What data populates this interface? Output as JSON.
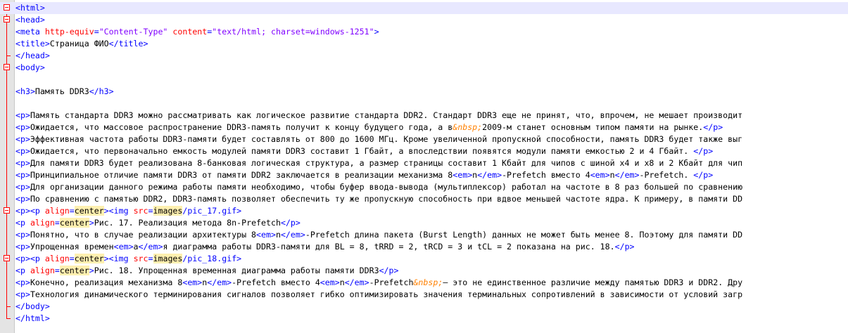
{
  "editor": {
    "language": "html",
    "colors": {
      "tag": "#0000ff",
      "attribute": "#ff0000",
      "value": "#8000ff",
      "entity": "#ff8000",
      "fold_marker": "#ff0000",
      "current_line": "#e8e8ff"
    },
    "lines": [
      {
        "fold": "box",
        "tree": "none",
        "current": true,
        "tokens": [
          [
            "tag",
            "<html>"
          ]
        ]
      },
      {
        "fold": "box",
        "tree": "line",
        "tokens": [
          [
            "tag",
            "<head>"
          ]
        ]
      },
      {
        "fold": "none",
        "tree": "line",
        "tokens": [
          [
            "tag",
            "<meta "
          ],
          [
            "attr",
            "http-equiv"
          ],
          [
            "tag",
            "="
          ],
          [
            "val",
            "\"Content-Type\""
          ],
          [
            "txt",
            " "
          ],
          [
            "attr",
            "content"
          ],
          [
            "tag",
            "="
          ],
          [
            "val",
            "\"text/html; charset=windows-1251\""
          ],
          [
            "tag",
            ">"
          ]
        ]
      },
      {
        "fold": "none",
        "tree": "line",
        "tokens": [
          [
            "tag",
            "<title>"
          ],
          [
            "txt",
            "Страница ФИО"
          ],
          [
            "tag",
            "</title>"
          ]
        ]
      },
      {
        "fold": "none",
        "tree": "end",
        "tokens": [
          [
            "tag",
            "</head>"
          ]
        ]
      },
      {
        "fold": "box",
        "tree": "line",
        "tokens": [
          [
            "tag",
            "<body>"
          ]
        ]
      },
      {
        "fold": "none",
        "tree": "line",
        "tokens": []
      },
      {
        "fold": "none",
        "tree": "line",
        "tokens": [
          [
            "tag",
            "<h3>"
          ],
          [
            "txt",
            "Память DDR3"
          ],
          [
            "tag",
            "</h3>"
          ]
        ]
      },
      {
        "fold": "none",
        "tree": "line",
        "tokens": []
      },
      {
        "fold": "none",
        "tree": "line",
        "tokens": [
          [
            "tag",
            "<p>"
          ],
          [
            "txt",
            "Память стандарта DDR3 можно рассматривать как логическое развитие стандарта DDR2. Стандарт DDR3 еще не принят, что, впрочем, не мешает производит"
          ]
        ]
      },
      {
        "fold": "none",
        "tree": "line",
        "tokens": [
          [
            "tag",
            "<p>"
          ],
          [
            "txt",
            "Ожидается, что массовое распространение DDR3-память получит к концу будущего года, а в"
          ],
          [
            "ent",
            "&nbsp;"
          ],
          [
            "txt",
            "2009-м станет основным типом памяти на рынке."
          ],
          [
            "tag",
            "</p>"
          ]
        ]
      },
      {
        "fold": "none",
        "tree": "line",
        "tokens": [
          [
            "tag",
            "<p>"
          ],
          [
            "txt",
            "Эффективная частота работы DDR3-памяти будет составлять от 800 до 1600 МГц. Кроме увеличенной пропускной способности, память DDR3 будет также выг"
          ]
        ]
      },
      {
        "fold": "none",
        "tree": "line",
        "tokens": [
          [
            "tag",
            "<p>"
          ],
          [
            "txt",
            "Ожидается, что первоначально емкость модулей памяти DDR3 составит 1 Гбайт, а впоследствии появятся модули памяти емкостью 2 и 4 Гбайт. "
          ],
          [
            "tag",
            "</p>"
          ]
        ]
      },
      {
        "fold": "none",
        "tree": "line",
        "tokens": [
          [
            "tag",
            "<p>"
          ],
          [
            "txt",
            "Для памяти DDR3 будет реализована 8-банковая логическая структура, а размер страницы составит 1 Кбайт для чипов с шиной х4 и х8 и 2 Кбайт для чип"
          ]
        ]
      },
      {
        "fold": "none",
        "tree": "line",
        "tokens": [
          [
            "tag",
            "<p>"
          ],
          [
            "txt",
            "Принципиальное отличие памяти DDR3 от памяти DDR2 заключается в реализации механизма 8"
          ],
          [
            "tag",
            "<em>"
          ],
          [
            "txt",
            "n"
          ],
          [
            "tag",
            "</em>"
          ],
          [
            "txt",
            "-Prefetch вместо 4"
          ],
          [
            "tag",
            "<em>"
          ],
          [
            "txt",
            "n"
          ],
          [
            "tag",
            "</em>"
          ],
          [
            "txt",
            "-Prefetch. "
          ],
          [
            "tag",
            "</p>"
          ]
        ]
      },
      {
        "fold": "none",
        "tree": "line",
        "tokens": [
          [
            "tag",
            "<p>"
          ],
          [
            "txt",
            "Для организации данного режима работы памяти необходимо, чтобы буфер ввода-вывода (мультиплексор) работал на частоте в 8 раз большей по сравнению"
          ]
        ]
      },
      {
        "fold": "none",
        "tree": "line",
        "tokens": [
          [
            "tag",
            "<p>"
          ],
          [
            "txt",
            "По сравнению с памятью DDR2, DDR3-память позволяет обеспечить ту же пропускную способность при вдвое меньшей частоте ядра. К примеру, в памяти DD"
          ]
        ]
      },
      {
        "fold": "box",
        "tree": "line",
        "tokens": [
          [
            "tag",
            "<p><p "
          ],
          [
            "attr",
            "align"
          ],
          [
            "tag",
            "="
          ],
          [
            "uval",
            "center"
          ],
          [
            "tag",
            "><img "
          ],
          [
            "attr",
            "src"
          ],
          [
            "tag",
            "="
          ],
          [
            "uval",
            "images"
          ],
          [
            "tag",
            "/pic_17.gif>"
          ]
        ]
      },
      {
        "fold": "none",
        "tree": "line",
        "tokens": [
          [
            "tag",
            "<p "
          ],
          [
            "attr",
            "align"
          ],
          [
            "tag",
            "="
          ],
          [
            "uval",
            "center"
          ],
          [
            "tag",
            ">"
          ],
          [
            "txt",
            "Рис. 17. Реализация метода 8n-Prefetch"
          ],
          [
            "tag",
            "</p>"
          ]
        ]
      },
      {
        "fold": "none",
        "tree": "line",
        "tokens": [
          [
            "tag",
            "<p>"
          ],
          [
            "txt",
            "Понятно, что в случае реализации архитектуры 8"
          ],
          [
            "tag",
            "<em>"
          ],
          [
            "txt",
            "n"
          ],
          [
            "tag",
            "</em>"
          ],
          [
            "txt",
            "-Prefetch длина пакета (Burst Length) данных не может быть менее 8. Поэтому для памяти DD"
          ]
        ]
      },
      {
        "fold": "none",
        "tree": "line",
        "tokens": [
          [
            "tag",
            "<p>"
          ],
          [
            "txt",
            "Упрощенная времен"
          ],
          [
            "tag",
            "<em>"
          ],
          [
            "txt",
            "а"
          ],
          [
            "tag",
            "</em>"
          ],
          [
            "txt",
            "я диаграмма работы DDR3-памяти для BL = 8, tRRD = 2, tRCD = 3 и tCL = 2 показана на рис. 18."
          ],
          [
            "tag",
            "</p>"
          ]
        ]
      },
      {
        "fold": "box",
        "tree": "line",
        "tokens": [
          [
            "tag",
            "<p><p "
          ],
          [
            "attr",
            "align"
          ],
          [
            "tag",
            "="
          ],
          [
            "uval",
            "center"
          ],
          [
            "tag",
            "><img "
          ],
          [
            "attr",
            "src"
          ],
          [
            "tag",
            "="
          ],
          [
            "uval",
            "images"
          ],
          [
            "tag",
            "/pic_18.gif>"
          ]
        ]
      },
      {
        "fold": "none",
        "tree": "line",
        "tokens": [
          [
            "tag",
            "<p "
          ],
          [
            "attr",
            "align"
          ],
          [
            "tag",
            "="
          ],
          [
            "uval",
            "center"
          ],
          [
            "tag",
            ">"
          ],
          [
            "txt",
            "Рис. 18. Упрощенная временная диаграмма работы памяти DDR3"
          ],
          [
            "tag",
            "</p>"
          ]
        ]
      },
      {
        "fold": "none",
        "tree": "line",
        "tokens": [
          [
            "tag",
            "<p>"
          ],
          [
            "txt",
            "Конечно, реализация механизма 8"
          ],
          [
            "tag",
            "<em>"
          ],
          [
            "txt",
            "n"
          ],
          [
            "tag",
            "</em>"
          ],
          [
            "txt",
            "-Prefetch вместо 4"
          ],
          [
            "tag",
            "<em>"
          ],
          [
            "txt",
            "n"
          ],
          [
            "tag",
            "</em>"
          ],
          [
            "txt",
            "-Prefetch"
          ],
          [
            "ent",
            "&nbsp;"
          ],
          [
            "txt",
            "— это не единственное различие между памятью DDR3 и DDR2. Дру"
          ]
        ]
      },
      {
        "fold": "none",
        "tree": "line",
        "tokens": [
          [
            "tag",
            "<p>"
          ],
          [
            "txt",
            "Технология динамического терминирования сигналов позволяет гибко оптимизировать значения терминальных сопротивлений в зависимости от условий загр"
          ]
        ]
      },
      {
        "fold": "none",
        "tree": "end",
        "tokens": [
          [
            "tag",
            "</body>"
          ]
        ]
      },
      {
        "fold": "none",
        "tree": "end-last",
        "tokens": [
          [
            "tag",
            "</html>"
          ]
        ]
      }
    ]
  }
}
